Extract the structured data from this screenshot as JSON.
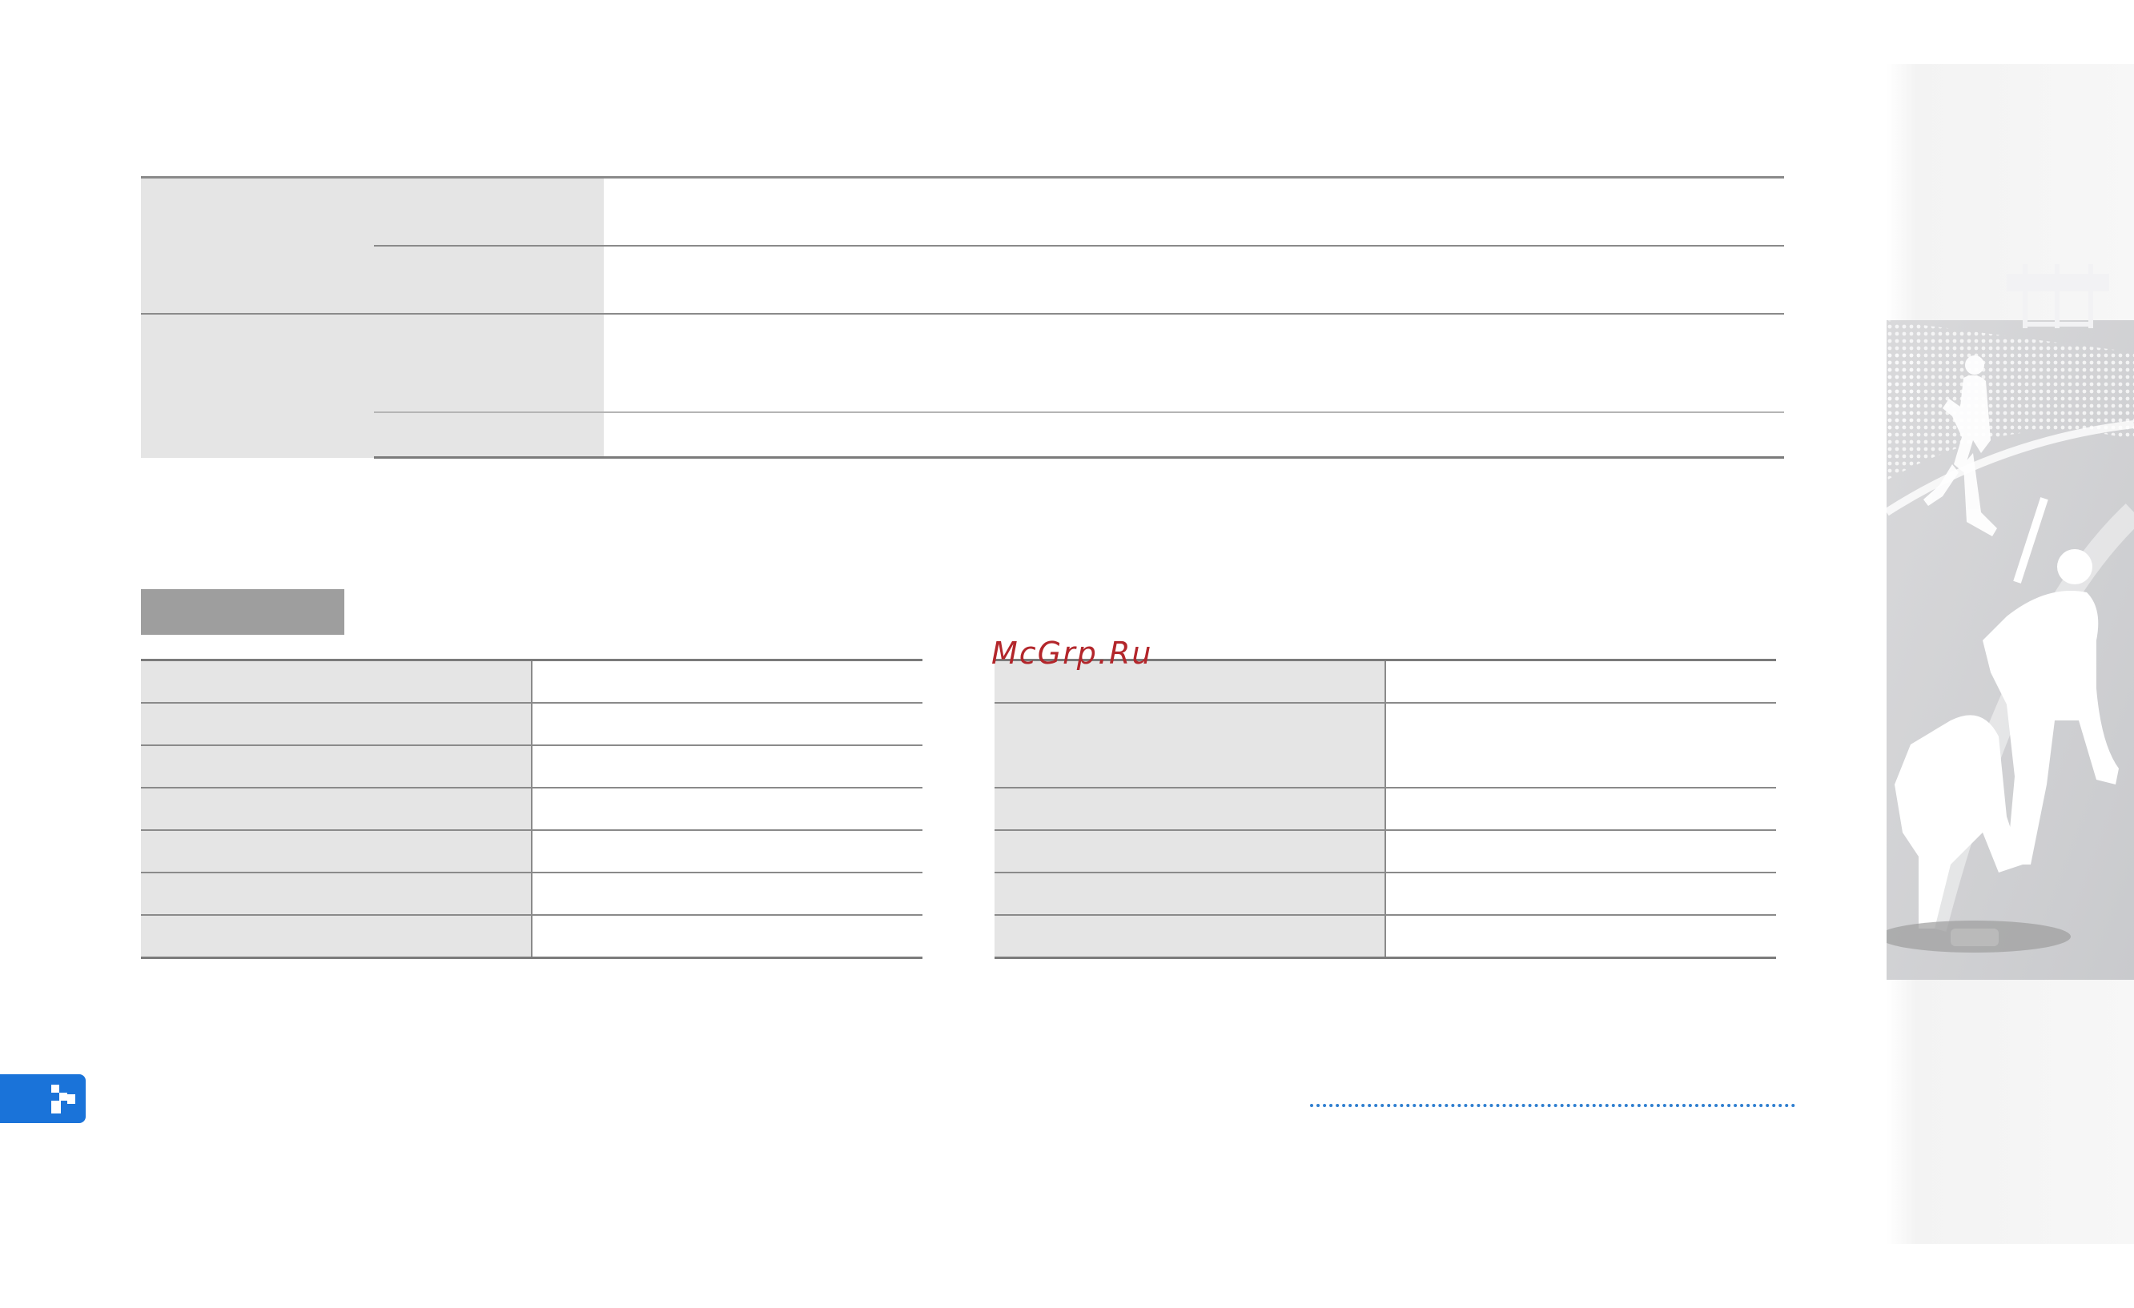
{
  "watermark": {
    "text": "McGrp.Ru"
  },
  "colors": {
    "accent_blue": "#1a73d9",
    "table_header_gray": "#e5e5e5",
    "section_box_gray": "#9e9e9e",
    "rule_gray": "#8a8a8a",
    "watermark_red": "#b3262b"
  },
  "icons": {
    "nav_tab": "pixel-arrow-icon",
    "side_art": "baseball-players-illustration"
  }
}
